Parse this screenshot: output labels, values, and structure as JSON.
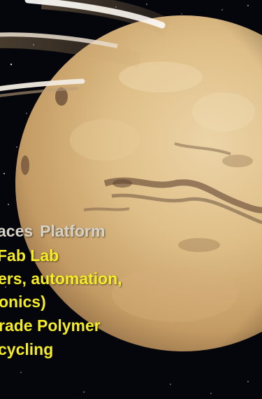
{
  "colors": {
    "space": "#05060c",
    "planet_light": "#e2c08a",
    "planet_dark": "#7b5b3a",
    "caption_gray": "#d7d2c6",
    "caption_yellow": "#f5ec26",
    "ring": "#ffffff"
  },
  "caption": {
    "line1_word1": "aces",
    "line1_word2": "Platform",
    "line2": "Fab Lab",
    "line3": "ers, automation,",
    "line4": "onics)",
    "line5": "rade Polymer",
    "line6": "cycling"
  }
}
